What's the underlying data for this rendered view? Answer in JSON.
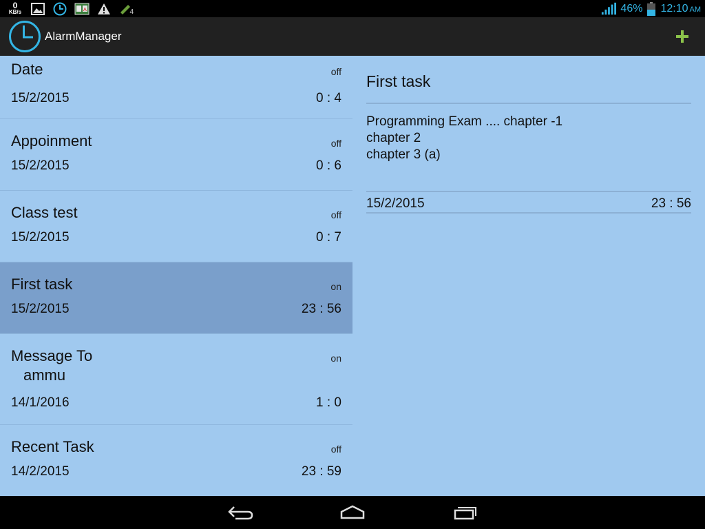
{
  "status_bar": {
    "net_speed": "0",
    "net_unit": "KB/s",
    "battery_percent": "46%",
    "time": "12:10",
    "ampm": "AM",
    "notification_badge": "4",
    "accent_color": "#33b5e5"
  },
  "action_bar": {
    "title": "AlarmManager",
    "add_icon": "plus-icon",
    "add_color": "#8bc34a"
  },
  "alarms": [
    {
      "title": "Date",
      "title_cont": "",
      "status": "off",
      "date": "15/2/2015",
      "time": "0 : 4"
    },
    {
      "title": "Appoinment",
      "title_cont": "",
      "status": "off",
      "date": "15/2/2015",
      "time": "0 : 6"
    },
    {
      "title": "Class test",
      "title_cont": "",
      "status": "off",
      "date": "15/2/2015",
      "time": "0 : 7"
    },
    {
      "title": "First task",
      "title_cont": "",
      "status": "on",
      "date": "15/2/2015",
      "time": "23 : 56",
      "selected": true
    },
    {
      "title": "Message To",
      "title_cont": "ammu",
      "status": "on",
      "date": "14/1/2016",
      "time": "1 : 0"
    },
    {
      "title": "Recent Task",
      "title_cont": "",
      "status": "off",
      "date": "14/2/2015",
      "time": "23 : 59"
    }
  ],
  "detail": {
    "title": "First task",
    "body": [
      "Programming Exam .... chapter -1",
      "chapter 2",
      "chapter 3 (a)"
    ],
    "date": "15/2/2015",
    "time": "23 : 56"
  }
}
